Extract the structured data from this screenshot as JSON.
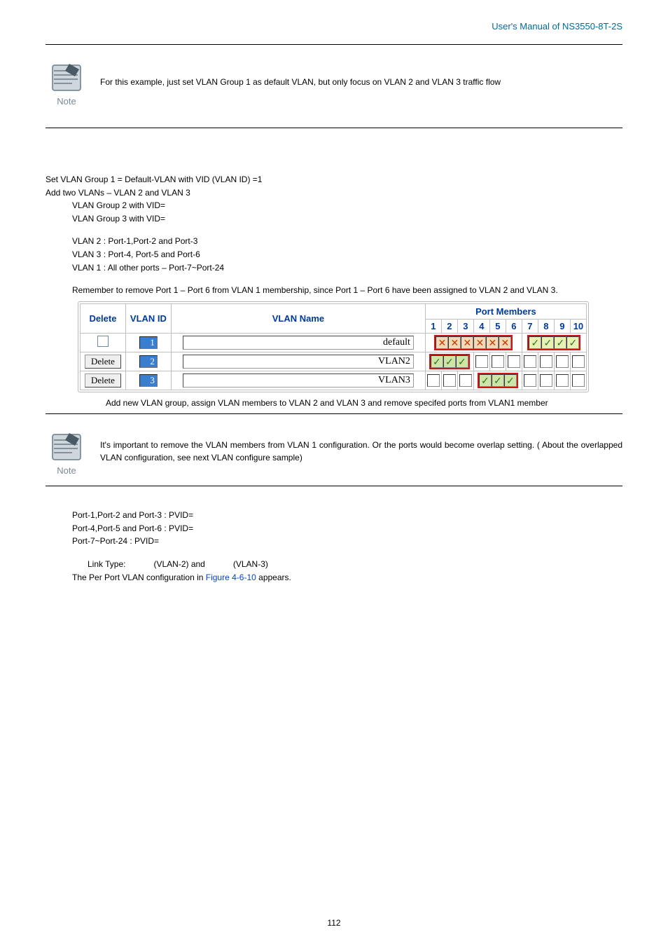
{
  "header": {
    "title": "User's Manual of NS3550-8T-2S"
  },
  "note1": {
    "label": "Note",
    "text": "For this example, just set VLAN Group 1 as default VLAN, but only focus on VLAN 2 and VLAN 3 traffic flow"
  },
  "setup": {
    "line1": "Set VLAN Group 1 = Default-VLAN with VID (VLAN ID) =1",
    "line2": "Add two VLANs – VLAN 2 and VLAN 3",
    "line3": "VLAN Group 2 with VID=",
    "line4": "VLAN Group 3 with VID=",
    "mem1": "VLAN 2 : Port-1,Port-2 and Port-3",
    "mem2": "VLAN 3 : Port-4, Port-5 and Port-6",
    "mem3": "VLAN 1 : All other ports – Port-7~Port-24",
    "remember": "Remember to remove Port 1 – Port 6 from VLAN 1 membership, since Port 1 – Port 6 have been assigned to VLAN 2 and VLAN 3."
  },
  "table": {
    "col_delete": "Delete",
    "col_vlanid": "VLAN ID",
    "col_vlanname": "VLAN Name",
    "col_portmembers": "Port Members",
    "ports": [
      "1",
      "2",
      "3",
      "4",
      "5",
      "6",
      "7",
      "8",
      "9",
      "10"
    ],
    "rows": [
      {
        "delete_type": "checkbox",
        "vlan_id": "1",
        "vlan_name": "default",
        "members": [
          "x",
          "x",
          "x",
          "x",
          "x",
          "x",
          "v",
          "v",
          "v",
          "v"
        ],
        "highlight_ranges": [
          "0-5",
          "6-9"
        ]
      },
      {
        "delete_type": "button",
        "delete_label": "Delete",
        "vlan_id": "2",
        "vlan_name": "VLAN2",
        "members": [
          "v",
          "v",
          "v",
          "e",
          "e",
          "e",
          "e",
          "e",
          "e",
          "e"
        ],
        "highlight_ranges": [
          "0-2"
        ]
      },
      {
        "delete_type": "button",
        "delete_label": "Delete",
        "vlan_id": "3",
        "vlan_name": "VLAN3",
        "members": [
          "e",
          "e",
          "e",
          "v",
          "v",
          "v",
          "e",
          "e",
          "e",
          "e"
        ],
        "highlight_ranges": [
          "3-5"
        ]
      }
    ]
  },
  "caption1": "Add new VLAN group, assign VLAN members to VLAN 2 and VLAN 3 and remove specifed ports from VLAN1 member",
  "note2": {
    "label": "Note",
    "text": "It's important to remove the VLAN members from VLAN 1 configuration. Or the ports would become overlap setting. ( About the overlapped VLAN configuration, see next VLAN configure sample)"
  },
  "pvid": {
    "l1": "Port-1,Port-2 and Port-3 : PVID=",
    "l2": "Port-4,Port-5 and Port-6 : PVID=",
    "l3": "Port-7~Port-24 : PVID="
  },
  "linktype": {
    "line": "Link Type:            (VLAN-2) and            (VLAN-3)",
    "conf_prefix": "The Per Port VLAN configuration in ",
    "conf_ref": "Figure 4-6-10",
    "conf_suffix": " appears."
  },
  "page_number": "112"
}
